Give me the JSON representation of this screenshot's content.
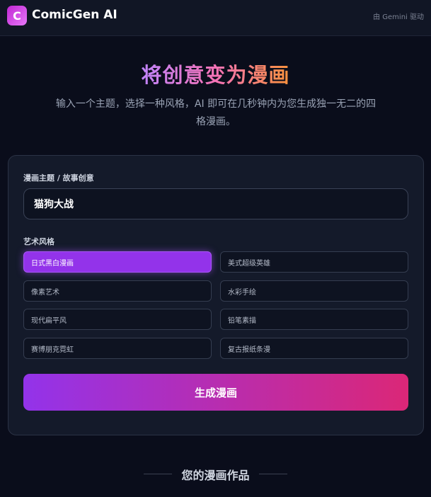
{
  "header": {
    "logo_letter": "C",
    "app_title": "ComicGen AI",
    "powered_by": "由 Gemini 驱动"
  },
  "hero": {
    "title": "将创意变为漫画",
    "subtitle": "输入一个主题，选择一种风格，AI 即可在几秒钟内为您生成独一无二的四格漫画。"
  },
  "form": {
    "topic_label": "漫画主题 / 故事创意",
    "topic_value": "猫狗大战",
    "style_label": "艺术风格",
    "styles": [
      {
        "label": "日式黑白漫画",
        "selected": true
      },
      {
        "label": "美式超级英雄",
        "selected": false
      },
      {
        "label": "像素艺术",
        "selected": false
      },
      {
        "label": "水彩手绘",
        "selected": false
      },
      {
        "label": "现代扁平风",
        "selected": false
      },
      {
        "label": "铅笔素描",
        "selected": false
      },
      {
        "label": "赛博朋克霓虹",
        "selected": false
      },
      {
        "label": "复古报纸条漫",
        "selected": false
      }
    ],
    "generate_label": "生成漫画"
  },
  "gallery": {
    "title": "您的漫画作品"
  },
  "colors": {
    "accent_purple": "#9333ea",
    "accent_pink": "#db2777",
    "background": "#0a0d1b"
  }
}
